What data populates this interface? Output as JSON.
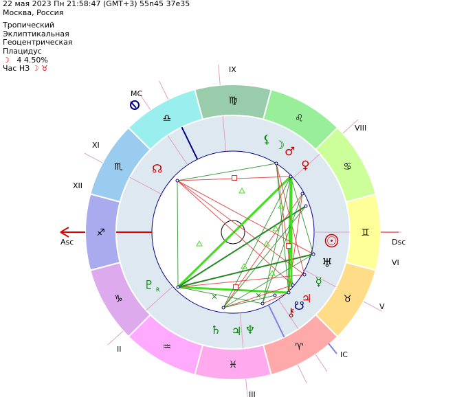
{
  "header": {
    "datetime": "22 мая 2023  Пн  21:58:47 (GMT+3) 55n45  37e35",
    "place": "Москва, Россия",
    "zodiac": "Тропический",
    "coords": "Эклиптикальная",
    "center": "Геоцентрическая",
    "houses": "Плацидус",
    "moon_symbol": "☽",
    "moon_phase": "4 4.50%",
    "hour_label": "Час НЗ",
    "hour_symbols": "☽ ♉"
  },
  "colors": {
    "sign_fills": [
      "#ffff99",
      "#ffdd88",
      "#ffaaaa",
      "#ffaaee",
      "#ffaaff",
      "#ddaaee",
      "#aaaaee",
      "#99ccee",
      "#99eeee",
      "#99ccaa",
      "#99ee99",
      "#ccff99"
    ],
    "ring_light": "#dde8f0",
    "asc_red": "#dd0000",
    "mc_navy": "#000080",
    "aspect_green": "#44dd22",
    "aspect_red": "#dd3333"
  },
  "zodiac": {
    "signs": [
      "♊",
      "♉",
      "♈",
      "♓",
      "♒",
      "♑",
      "♐",
      "♏",
      "♎",
      "♍",
      "♌",
      "♋"
    ],
    "sign_names": [
      "gemini",
      "taurus",
      "aries",
      "pisces",
      "aquarius",
      "capricorn",
      "sagittarius",
      "scorpio",
      "libra",
      "virgo",
      "leo",
      "cancer"
    ]
  },
  "houses": {
    "labels": [
      "Asc",
      "XII",
      "XI",
      "MC",
      "IX",
      "VIII",
      "Dsc",
      "VI",
      "V",
      "IC",
      "III",
      "II"
    ]
  },
  "planets": [
    {
      "name": "moon",
      "glyph": "☽",
      "color": "#008800"
    },
    {
      "name": "venus",
      "glyph": "♀",
      "color": "#cc0000"
    },
    {
      "name": "mars",
      "glyph": "♂",
      "color": "#cc0000"
    },
    {
      "name": "lilith",
      "glyph": "⚸",
      "color": "#008800"
    },
    {
      "name": "north-node",
      "glyph": "☊",
      "color": "#cc0000"
    },
    {
      "name": "pluto",
      "glyph": "♇",
      "color": "#008800",
      "retro": "R"
    },
    {
      "name": "saturn",
      "glyph": "♄",
      "color": "#008800"
    },
    {
      "name": "neptune",
      "glyph": "♆",
      "color": "#008800"
    },
    {
      "name": "jupiter-cluster",
      "glyph": "♃",
      "color": "#008800"
    },
    {
      "name": "sun",
      "glyph": "☉",
      "color": "#cc0000"
    },
    {
      "name": "uranus",
      "glyph": "♅",
      "color": "#000000"
    },
    {
      "name": "mercury",
      "glyph": "☿",
      "color": "#008800"
    },
    {
      "name": "jupiter",
      "glyph": "♃",
      "color": "#cc0000"
    },
    {
      "name": "south-node",
      "glyph": "☋",
      "color": "#000080"
    },
    {
      "name": "chiron",
      "glyph": "⚷",
      "color": "#cc0000"
    }
  ]
}
